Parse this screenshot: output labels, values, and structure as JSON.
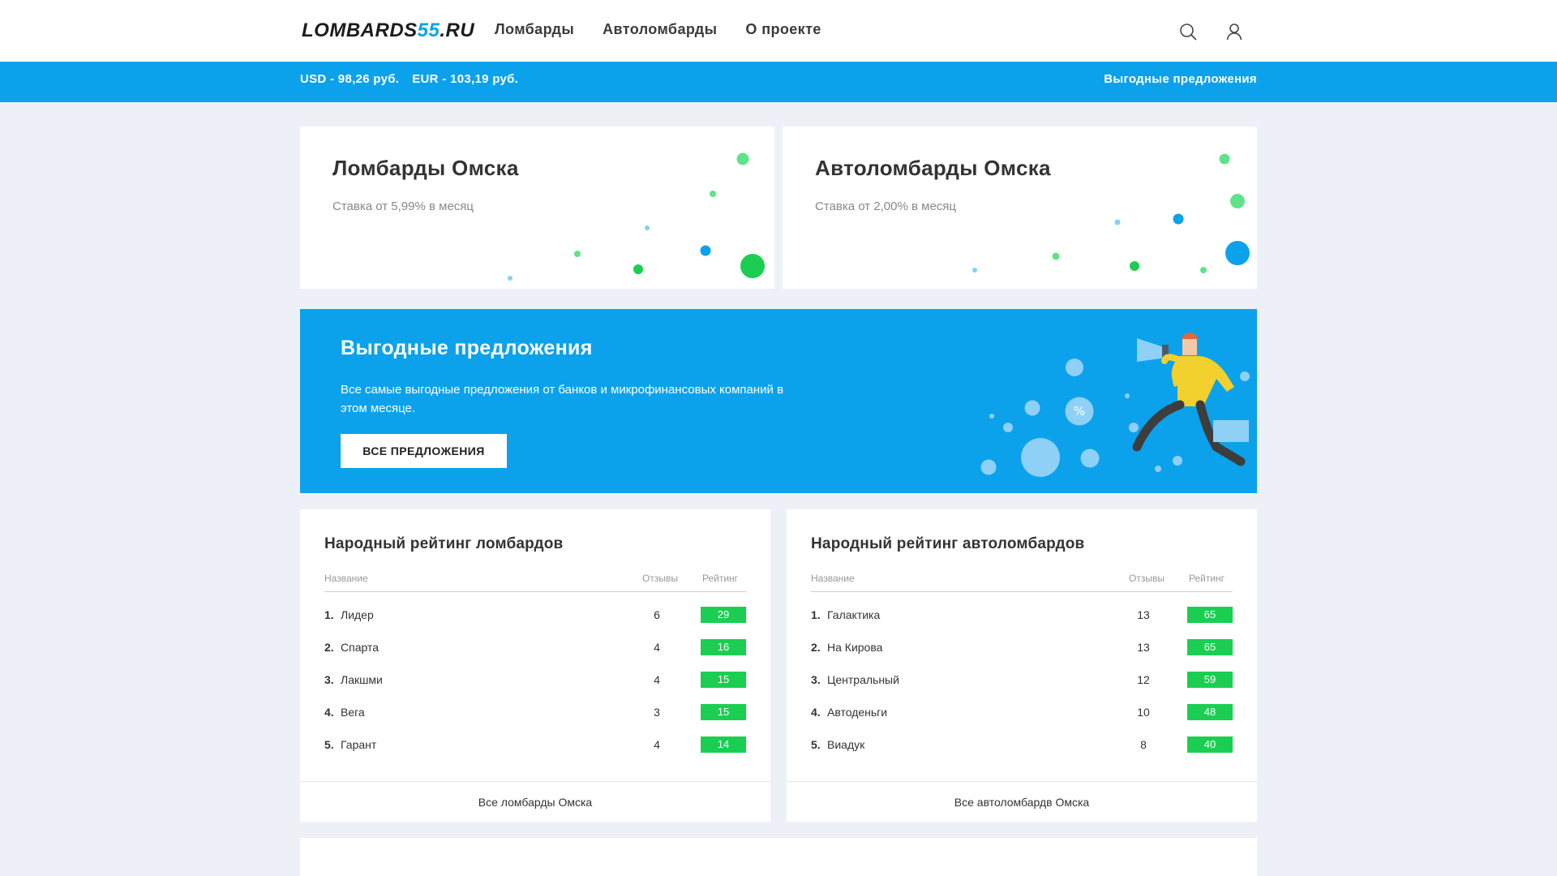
{
  "header": {
    "logo_main": "LOMBARDS",
    "logo_num": "55",
    "logo_tld": ".RU",
    "nav": [
      "Ломбарды",
      "Автоломбарды",
      "О проекте"
    ],
    "icons": [
      "search-icon",
      "user-icon"
    ]
  },
  "rates_bar": {
    "usd": "USD - 98,26 руб.",
    "eur": "EUR - 103,19 руб.",
    "offers_link": "Выгодные предложения"
  },
  "cards": [
    {
      "title": "Ломбарды Омска",
      "subtitle": "Ставка от 5,99% в месяц"
    },
    {
      "title": "Автоломбарды Омска",
      "subtitle": "Ставка от 2,00% в месяц"
    }
  ],
  "promo": {
    "title": "Выгодные предложения",
    "description": "Все самые выгодные предложения от банков и микрофинансовых компаний в этом месяце.",
    "button": "ВСЕ ПРЕДЛОЖЕНИЯ",
    "percent_symbol": "%"
  },
  "ratings": [
    {
      "title": "Народный рейтинг ломбардов",
      "col_name": "Название",
      "col_reviews": "Отзывы",
      "col_rating": "Рейтинг",
      "rows": [
        {
          "num": "1.",
          "name": "Лидер",
          "reviews": "6",
          "rating": "29"
        },
        {
          "num": "2.",
          "name": "Спарта",
          "reviews": "4",
          "rating": "16"
        },
        {
          "num": "3.",
          "name": "Лакшми",
          "reviews": "4",
          "rating": "15"
        },
        {
          "num": "4.",
          "name": "Вега",
          "reviews": "3",
          "rating": "15"
        },
        {
          "num": "5.",
          "name": "Гарант",
          "reviews": "4",
          "rating": "14"
        }
      ],
      "footer": "Все ломбарды Омска"
    },
    {
      "title": "Народный рейтинг автоломбардов",
      "col_name": "Название",
      "col_reviews": "Отзывы",
      "col_rating": "Рейтинг",
      "rows": [
        {
          "num": "1.",
          "name": "Галактика",
          "reviews": "13",
          "rating": "65"
        },
        {
          "num": "2.",
          "name": "На Кирова",
          "reviews": "13",
          "rating": "65"
        },
        {
          "num": "3.",
          "name": "Центральный",
          "reviews": "12",
          "rating": "59"
        },
        {
          "num": "4.",
          "name": "Автоденьги",
          "reviews": "10",
          "rating": "48"
        },
        {
          "num": "5.",
          "name": "Виадук",
          "reviews": "8",
          "rating": "40"
        }
      ],
      "footer": "Все автоломбардв Омска"
    }
  ],
  "colors": {
    "accent_blue": "#0ba2eb",
    "rating_green": "#1bce52",
    "dot_light_green": "#5fe389",
    "dot_light_blue": "#7fd3f5",
    "page_bg": "#edf1f7"
  }
}
